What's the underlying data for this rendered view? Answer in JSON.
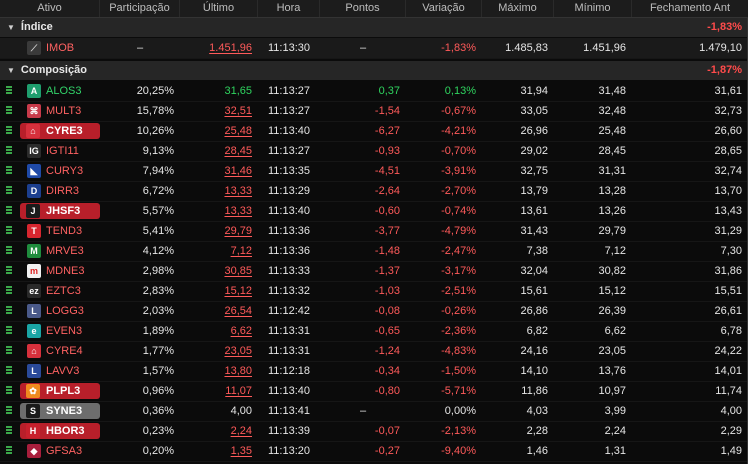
{
  "columns": [
    "Ativo",
    "Participação",
    "Último",
    "Hora",
    "Pontos",
    "Variação",
    "Máximo",
    "Mínimo",
    "Fechamento Ant"
  ],
  "indice": {
    "label": "Índice",
    "variacao": "-1,83%",
    "row": {
      "ativo": "IMOB",
      "participacao": "–",
      "ultimo": "1.451,96",
      "hora": "11:13:30",
      "pontos": "–",
      "variacao": "-1,83%",
      "maximo": "1.485,83",
      "minimo": "1.451,96",
      "fechamento": "1.479,10",
      "logo_color": "#3a3a3a",
      "logo_icon": "imob-icon",
      "logo_glyph": "⟋"
    }
  },
  "composicao": {
    "label": "Composição",
    "variacao": "-1,87%",
    "rows": [
      {
        "ativo": "ALOS3",
        "participacao": "20,25%",
        "ultimo": "31,65",
        "hora": "11:13:27",
        "pontos": "0,37",
        "variacao": "0,13%",
        "maximo": "31,94",
        "minimo": "31,48",
        "fechamento": "31,61",
        "dir": "pos",
        "logo_color": "#1f9e6e",
        "logo_icon": "alos-logo-icon",
        "logo_glyph": "A"
      },
      {
        "ativo": "MULT3",
        "participacao": "15,78%",
        "ultimo": "32,51",
        "hora": "11:13:27",
        "pontos": "-1,54",
        "variacao": "-0,67%",
        "maximo": "33,05",
        "minimo": "32,48",
        "fechamento": "32,73",
        "dir": "neg",
        "logo_color": "#c83a4a",
        "logo_icon": "mult-logo-icon",
        "logo_glyph": "⌘"
      },
      {
        "ativo": "CYRE3",
        "participacao": "10,26%",
        "ultimo": "25,48",
        "hora": "11:13:40",
        "pontos": "-6,27",
        "variacao": "-4,21%",
        "maximo": "26,96",
        "minimo": "25,48",
        "fechamento": "26,60",
        "dir": "neg",
        "badge": "red",
        "logo_color": "#d7303c",
        "logo_icon": "cyre-logo-icon",
        "logo_glyph": "⌂"
      },
      {
        "ativo": "IGTI11",
        "participacao": "9,13%",
        "ultimo": "28,45",
        "hora": "11:13:27",
        "pontos": "-0,93",
        "variacao": "-0,70%",
        "maximo": "29,02",
        "minimo": "28,45",
        "fechamento": "28,65",
        "dir": "neg",
        "logo_color": "#2b2b2b",
        "logo_icon": "igti-logo-icon",
        "logo_glyph": "IG"
      },
      {
        "ativo": "CURY3",
        "participacao": "7,94%",
        "ultimo": "31,46",
        "hora": "11:13:35",
        "pontos": "-4,51",
        "variacao": "-3,91%",
        "maximo": "32,75",
        "minimo": "31,31",
        "fechamento": "32,74",
        "dir": "neg",
        "logo_color": "#1f4aa8",
        "logo_icon": "cury-logo-icon",
        "logo_glyph": "◣"
      },
      {
        "ativo": "DIRR3",
        "participacao": "6,72%",
        "ultimo": "13,33",
        "hora": "11:13:29",
        "pontos": "-2,64",
        "variacao": "-2,70%",
        "maximo": "13,79",
        "minimo": "13,28",
        "fechamento": "13,70",
        "dir": "neg",
        "logo_color": "#1c3f8f",
        "logo_icon": "dirr-logo-icon",
        "logo_glyph": "D"
      },
      {
        "ativo": "JHSF3",
        "participacao": "5,57%",
        "ultimo": "13,33",
        "hora": "11:13:40",
        "pontos": "-0,60",
        "variacao": "-0,74%",
        "maximo": "13,61",
        "minimo": "13,26",
        "fechamento": "13,43",
        "dir": "neg",
        "badge": "red",
        "logo_color": "#1b1b1b",
        "logo_icon": "jhsf-logo-icon",
        "logo_glyph": "J"
      },
      {
        "ativo": "TEND3",
        "participacao": "5,41%",
        "ultimo": "29,79",
        "hora": "11:13:36",
        "pontos": "-3,77",
        "variacao": "-4,79%",
        "maximo": "31,43",
        "minimo": "29,79",
        "fechamento": "31,29",
        "dir": "neg",
        "logo_color": "#d7262f",
        "logo_icon": "tend-logo-icon",
        "logo_glyph": "T"
      },
      {
        "ativo": "MRVE3",
        "participacao": "4,12%",
        "ultimo": "7,12",
        "hora": "11:13:36",
        "pontos": "-1,48",
        "variacao": "-2,47%",
        "maximo": "7,38",
        "minimo": "7,12",
        "fechamento": "7,30",
        "dir": "neg",
        "logo_color": "#1f8c3d",
        "logo_icon": "mrve-logo-icon",
        "logo_glyph": "M"
      },
      {
        "ativo": "MDNE3",
        "participacao": "2,98%",
        "ultimo": "30,85",
        "hora": "11:13:33",
        "pontos": "-1,37",
        "variacao": "-3,17%",
        "maximo": "32,04",
        "minimo": "30,82",
        "fechamento": "31,86",
        "dir": "neg",
        "logo_color": "#f2f2f2",
        "logo_icon": "mdne-logo-icon",
        "logo_glyph": "m"
      },
      {
        "ativo": "EZTC3",
        "participacao": "2,83%",
        "ultimo": "15,12",
        "hora": "11:13:32",
        "pontos": "-1,03",
        "variacao": "-2,51%",
        "maximo": "15,61",
        "minimo": "15,12",
        "fechamento": "15,51",
        "dir": "neg",
        "logo_color": "#2a2a2a",
        "logo_icon": "eztc-logo-icon",
        "logo_glyph": "ez"
      },
      {
        "ativo": "LOGG3",
        "participacao": "2,03%",
        "ultimo": "26,54",
        "hora": "11:12:42",
        "pontos": "-0,08",
        "variacao": "-0,26%",
        "maximo": "26,86",
        "minimo": "26,39",
        "fechamento": "26,61",
        "dir": "neg",
        "logo_color": "#4a5a8a",
        "logo_icon": "logg-logo-icon",
        "logo_glyph": "L"
      },
      {
        "ativo": "EVEN3",
        "participacao": "1,89%",
        "ultimo": "6,62",
        "hora": "11:13:31",
        "pontos": "-0,65",
        "variacao": "-2,36%",
        "maximo": "6,82",
        "minimo": "6,62",
        "fechamento": "6,78",
        "dir": "neg",
        "logo_color": "#1aa5a5",
        "logo_icon": "even-logo-icon",
        "logo_glyph": "e"
      },
      {
        "ativo": "CYRE4",
        "participacao": "1,77%",
        "ultimo": "23,05",
        "hora": "11:13:31",
        "pontos": "-1,24",
        "variacao": "-4,83%",
        "maximo": "24,16",
        "minimo": "23,05",
        "fechamento": "24,22",
        "dir": "neg",
        "logo_color": "#d7303c",
        "logo_icon": "cyre-logo-icon",
        "logo_glyph": "⌂"
      },
      {
        "ativo": "LAVV3",
        "participacao": "1,57%",
        "ultimo": "13,80",
        "hora": "11:12:18",
        "pontos": "-0,34",
        "variacao": "-1,50%",
        "maximo": "14,10",
        "minimo": "13,76",
        "fechamento": "14,01",
        "dir": "neg",
        "logo_color": "#2a4a9a",
        "logo_icon": "lavv-logo-icon",
        "logo_glyph": "L"
      },
      {
        "ativo": "PLPL3",
        "participacao": "0,96%",
        "ultimo": "11,07",
        "hora": "11:13:40",
        "pontos": "-0,80",
        "variacao": "-5,71%",
        "maximo": "11,86",
        "minimo": "10,97",
        "fechamento": "11,74",
        "dir": "neg",
        "badge": "red",
        "logo_color": "#f08a1e",
        "logo_icon": "plpl-logo-icon",
        "logo_glyph": "✿"
      },
      {
        "ativo": "SYNE3",
        "participacao": "0,36%",
        "ultimo": "4,00",
        "hora": "11:13:41",
        "pontos": "–",
        "variacao": "0,00%",
        "maximo": "4,03",
        "minimo": "3,99",
        "fechamento": "4,00",
        "dir": "neu",
        "badge": "gray",
        "logo_color": "#1a1a1a",
        "logo_icon": "syne-logo-icon",
        "logo_glyph": "S"
      },
      {
        "ativo": "HBOR3",
        "participacao": "0,23%",
        "ultimo": "2,24",
        "hora": "11:13:39",
        "pontos": "-0,07",
        "variacao": "-2,13%",
        "maximo": "2,28",
        "minimo": "2,24",
        "fechamento": "2,29",
        "dir": "neg",
        "badge": "red",
        "logo_color": "#c8202c",
        "logo_icon": "hbor-logo-icon",
        "logo_glyph": "H"
      },
      {
        "ativo": "GFSA3",
        "participacao": "0,20%",
        "ultimo": "1,35",
        "hora": "11:13:20",
        "pontos": "-0,27",
        "variacao": "-9,40%",
        "maximo": "1,46",
        "minimo": "1,31",
        "fechamento": "1,49",
        "dir": "neg",
        "logo_color": "#a81e3c",
        "logo_icon": "gfsa-logo-icon",
        "logo_glyph": "◆"
      }
    ]
  },
  "colors": {
    "positive": "#2fd45f",
    "negative": "#ff5a5a",
    "badge_red": "#b81f2a",
    "badge_gray": "#6d6d6d",
    "grip": "#3ba84a"
  }
}
